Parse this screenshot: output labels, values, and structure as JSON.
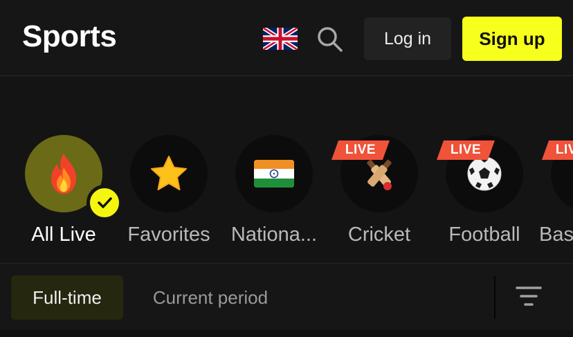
{
  "header": {
    "title": "Sports",
    "language_icon": "uk-flag-icon",
    "search_icon": "search-icon",
    "login_label": "Log in",
    "signup_label": "Sign up"
  },
  "colors": {
    "accent": "#f7ff1c",
    "live": "#f0533a",
    "background": "#141414"
  },
  "sports": [
    {
      "label": "All Live",
      "icon": "fire-icon",
      "active": true,
      "live": false
    },
    {
      "label": "Favorites",
      "icon": "star-icon",
      "active": false,
      "live": false
    },
    {
      "label": "Nationa...",
      "icon": "india-flag-icon",
      "active": false,
      "live": false
    },
    {
      "label": "Cricket",
      "icon": "cricket-icon",
      "active": false,
      "live": true,
      "badge": "LIVE"
    },
    {
      "label": "Football",
      "icon": "football-icon",
      "active": false,
      "live": true,
      "badge": "LIVE"
    },
    {
      "label": "Bas",
      "icon": "basketball-icon",
      "active": false,
      "live": true,
      "badge": "LIVE"
    }
  ],
  "tabs": [
    {
      "label": "Full-time",
      "active": true
    },
    {
      "label": "Current period",
      "active": false
    }
  ],
  "filter_icon": "filter-icon"
}
